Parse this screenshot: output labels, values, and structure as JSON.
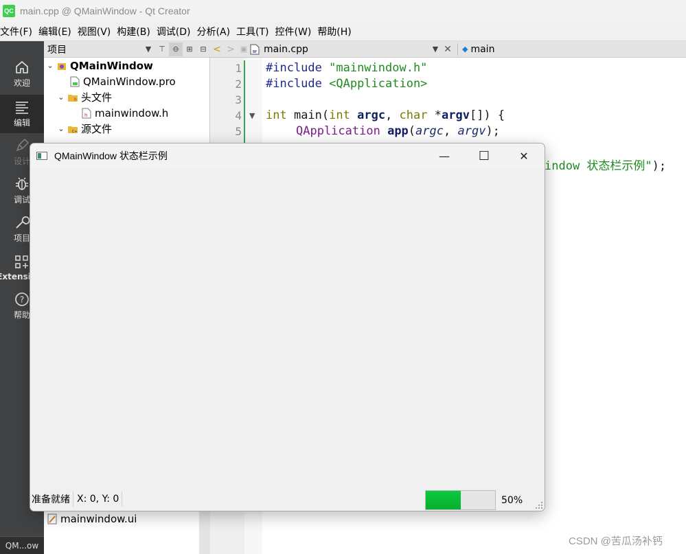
{
  "window": {
    "title": "main.cpp @ QMainWindow - Qt Creator",
    "logo_text": "QC"
  },
  "menu": [
    "文件(F)",
    "编辑(E)",
    "视图(V)",
    "构建(B)",
    "调试(D)",
    "分析(A)",
    "工具(T)",
    "控件(W)",
    "帮助(H)"
  ],
  "modes": [
    {
      "label": "欢迎",
      "icon": "home-icon"
    },
    {
      "label": "编辑",
      "icon": "edit-lines-icon",
      "active": true
    },
    {
      "label": "设计",
      "icon": "pen-icon",
      "disabled": true
    },
    {
      "label": "调试",
      "icon": "bug-icon"
    },
    {
      "label": "项目",
      "icon": "wrench-icon"
    },
    {
      "label": "Extensions",
      "icon": "extensions-icon"
    },
    {
      "label": "帮助",
      "icon": "help-icon"
    }
  ],
  "mode_bottom": "QM...ow",
  "project_panel": {
    "header": "项目",
    "tree": {
      "root": "QMainWindow",
      "pro": "QMainWindow.pro",
      "headers": "头文件",
      "header_file": "mainwindow.h",
      "sources": "源文件",
      "forms_file": "mainwindow.ui"
    }
  },
  "editor": {
    "file": "main.cpp",
    "symbol": "main",
    "line_numbers": [
      "1",
      "2",
      "3",
      "4",
      "5"
    ],
    "code": {
      "l1_pp": "#include ",
      "l1_str": "\"mainwindow.h\"",
      "l2_pp": "#include ",
      "l2_str": "<QApplication>",
      "l4_kw1": "int",
      "l4_fn": " main(",
      "l4_kw2": "int",
      "l4_sp": " ",
      "l4_argc": "argc",
      "l4_c": ", ",
      "l4_kw3": "char",
      "l4_star": " *",
      "l4_argv": "argv",
      "l4_end": "[]) {",
      "l5_cls": "QApplication",
      "l5_sp": " ",
      "l5_app": "app",
      "l5_open": "(",
      "l5_a1": "argc",
      "l5_c": ", ",
      "l5_a2": "argv",
      "l5_end": ");",
      "l7_str": "indow 状态栏示例\"",
      "l7_end": ");"
    }
  },
  "popup": {
    "title": "QMainWindow 状态栏示例",
    "min_glyph": "—",
    "max_glyph": "☐",
    "close_glyph": "✕",
    "status_message": "准备就绪",
    "coords": "X: 0, Y: 0",
    "progress_value": 0.5,
    "progress_text": "50%"
  },
  "watermark": "CSDN @苦瓜汤补钙"
}
